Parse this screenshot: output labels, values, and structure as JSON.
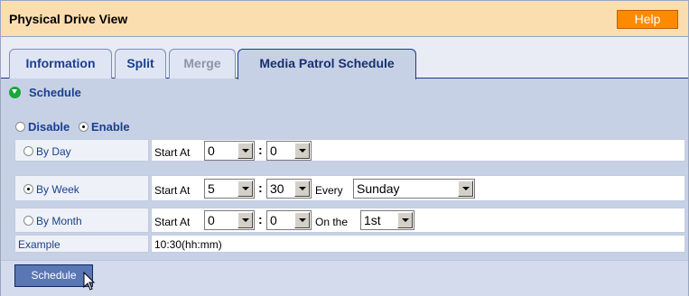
{
  "window": {
    "title": "Physical Drive View",
    "help_label": "Help"
  },
  "tabs": [
    {
      "label": "Information",
      "state": "normal"
    },
    {
      "label": "Split",
      "state": "normal"
    },
    {
      "label": "Merge",
      "state": "disabled"
    },
    {
      "label": "Media Patrol Schedule",
      "state": "active"
    }
  ],
  "section": {
    "title": "Schedule",
    "icon": "collapse-down-icon"
  },
  "mode": {
    "disable_label": "Disable",
    "enable_label": "Enable",
    "selected": "Enable"
  },
  "rows": {
    "by_day": {
      "label": "By Day",
      "selected": false,
      "start_label": "Start At",
      "hour": "0",
      "minute": "0"
    },
    "by_week": {
      "label": "By Week",
      "selected": true,
      "start_label": "Start At",
      "hour": "5",
      "minute": "30",
      "every_label": "Every",
      "day": "Sunday"
    },
    "by_month": {
      "label": "By Month",
      "selected": false,
      "start_label": "Start At",
      "hour": "0",
      "minute": "0",
      "on_label": "On the",
      "date": "1st"
    },
    "example": {
      "label": "Example",
      "value": "10:30(hh:mm)"
    }
  },
  "separator": ":",
  "buttons": {
    "schedule_label": "Schedule"
  },
  "colors": {
    "title_bar": "#fbdeb0",
    "help_button": "#ff8a00",
    "panel": "#c7d1e6",
    "tab_text": "#1b3f8f",
    "schedule_button": "#5a76b4"
  }
}
